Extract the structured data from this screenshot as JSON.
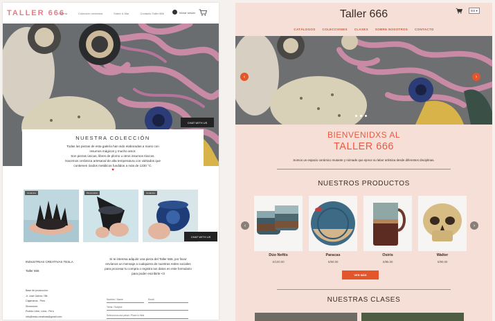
{
  "left": {
    "logo": "TALLER 666",
    "menu": [
      "Galería",
      "Colección cerámica",
      "Sobre & Mar",
      "Contacto Taller 666"
    ],
    "login": "Iniciar sesión",
    "chat_label": "CHAT WITH US",
    "collection": {
      "title": "NUESTRA COLECCIÓN",
      "body": "Todas las piezas de esta galería han sido elaboradas a mano con\ninsumos mágicos y mucho amor.\nSon piezas únicas, libres de plomo u otros insumos tóxicos.\nHacemos cerámica artesanal de alta temperatura con vidriados que\ncontienen óxidos metálicos fundidos a más de 1230 °C.",
      "heart": "♥"
    },
    "gallery_tags": [
      "Cerámica",
      "Pieza única",
      "Cerámica"
    ],
    "footer": {
      "company": "INDUSTRIAS CREATIVAS TESLA",
      "taller": "Taller 666",
      "info": [
        "Base de producción:",
        "Jr. José Gálvez 786",
        "Cajamarca - Perú",
        "Showroom:",
        "Pueblo Libre, Lima - Perú",
        "info@tesla.creativas@gmail.com"
      ],
      "message": "Si te interesa adquirir una pieza del Taller 666, por favor envíanos un mensaje a cualquiera de nuestras redes sociales para procesar tu compra o registra tus datos en este formulario para poder escribirte <3",
      "fields": {
        "name": "Nombre / Name",
        "email": "Email",
        "subject": "Tema / Subject",
        "piece": "Selecciona una pieza / Place in field"
      }
    }
  },
  "right": {
    "logo": "Taller 666",
    "lang": "ES ▾",
    "menu": [
      "CATÁLOGOS",
      "COLECCIONES",
      "CLASES",
      "SOBRE NOSOTROS",
      "CONTACTO"
    ],
    "welcome_line1": "BIENVENIDXS AL",
    "welcome_line2": "TALLER 666",
    "tagline": "Somos un espacio cerámico mutante y nómade que ejerce su labor artística desde diferentes disciplinas.",
    "products_heading": "NUESTROS PRODUCTOS",
    "products": [
      {
        "name": "Dúo Neftis",
        "price": "S/100.00"
      },
      {
        "name": "Paracas",
        "price": "S/60.00"
      },
      {
        "name": "Osiris",
        "price": "S/85.00"
      },
      {
        "name": "Walter",
        "price": "S/90.00"
      }
    ],
    "see_more": "VER MÁS",
    "classes_heading": "NUESTRAS CLASES"
  },
  "colors": {
    "accent_orange": "#e3552a",
    "pink_logo": "#e87a86",
    "right_bg": "#f5dfd6"
  }
}
